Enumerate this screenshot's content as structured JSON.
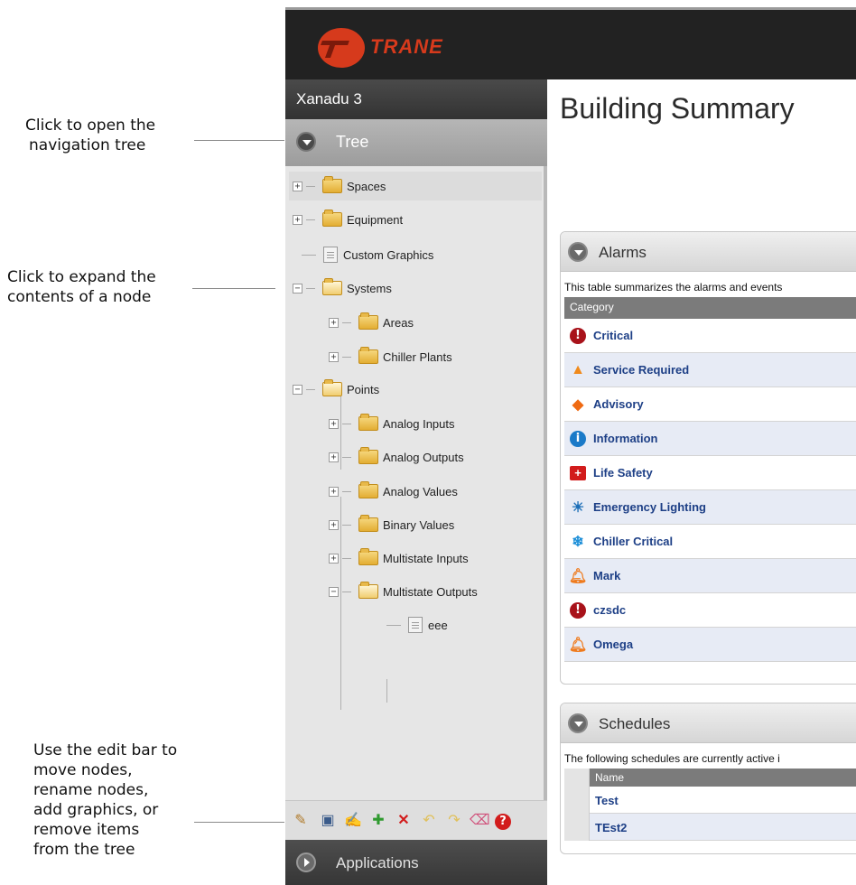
{
  "callouts": {
    "tree": [
      "Click to open the",
      "navigation tree"
    ],
    "expand": [
      "Click to expand the",
      "contents of a node"
    ],
    "editbar": [
      "Use the edit bar to",
      "move nodes,",
      "rename nodes,",
      "add graphics, or",
      "remove items",
      "from the tree"
    ]
  },
  "brand": {
    "logo_text": "TRANE",
    "accent": "#d63a1c"
  },
  "sidebar": {
    "site_name": "Xanadu 3",
    "tree_label": "Tree",
    "applications_label": "Applications",
    "tree": [
      {
        "label": "Spaces",
        "icon": "folder-icon"
      },
      {
        "label": "Equipment",
        "icon": "folder-icon"
      },
      {
        "label": "Custom Graphics",
        "icon": "document-icon"
      },
      {
        "label": "Systems",
        "icon": "folder-open-icon"
      },
      {
        "label": "Areas",
        "icon": "folder-icon"
      },
      {
        "label": "Chiller Plants",
        "icon": "folder-icon"
      },
      {
        "label": "Points",
        "icon": "folder-open-icon"
      },
      {
        "label": "Analog Inputs",
        "icon": "folder-icon"
      },
      {
        "label": "Analog Outputs",
        "icon": "folder-icon"
      },
      {
        "label": "Analog Values",
        "icon": "folder-icon"
      },
      {
        "label": "Binary Values",
        "icon": "folder-icon"
      },
      {
        "label": "Multistate Inputs",
        "icon": "folder-icon"
      },
      {
        "label": "Multistate Outputs",
        "icon": "folder-open-icon"
      },
      {
        "label": "eee",
        "icon": "document-icon"
      }
    ],
    "edit_bar_icons": [
      "move-icon",
      "rename-icon",
      "edit-icon",
      "add-graphic-icon",
      "delete-icon",
      "undo-icon",
      "redo-icon",
      "eraser-icon",
      "help-icon"
    ]
  },
  "main": {
    "title": "Building Summary",
    "alarms": {
      "heading": "Alarms",
      "description": "This table summarizes the alarms and events",
      "column_category": "Category",
      "rows": [
        {
          "label": "Critical",
          "icon": "critical-icon"
        },
        {
          "label": "Service Required",
          "icon": "warning-triangle-icon"
        },
        {
          "label": "Advisory",
          "icon": "advisory-diamond-icon"
        },
        {
          "label": "Information",
          "icon": "info-icon"
        },
        {
          "label": "Life Safety",
          "icon": "first-aid-icon"
        },
        {
          "label": "Emergency Lighting",
          "icon": "emergency-light-icon"
        },
        {
          "label": "Chiller Critical",
          "icon": "snowflake-icon"
        },
        {
          "label": "Mark",
          "icon": "bell-icon"
        },
        {
          "label": "czsdc",
          "icon": "critical-icon"
        },
        {
          "label": "Omega",
          "icon": "bell-icon"
        }
      ]
    },
    "schedules": {
      "heading": "Schedules",
      "description": "The following schedules are currently active i",
      "column_name": "Name",
      "rows": [
        "Test",
        "TEst2"
      ]
    }
  }
}
